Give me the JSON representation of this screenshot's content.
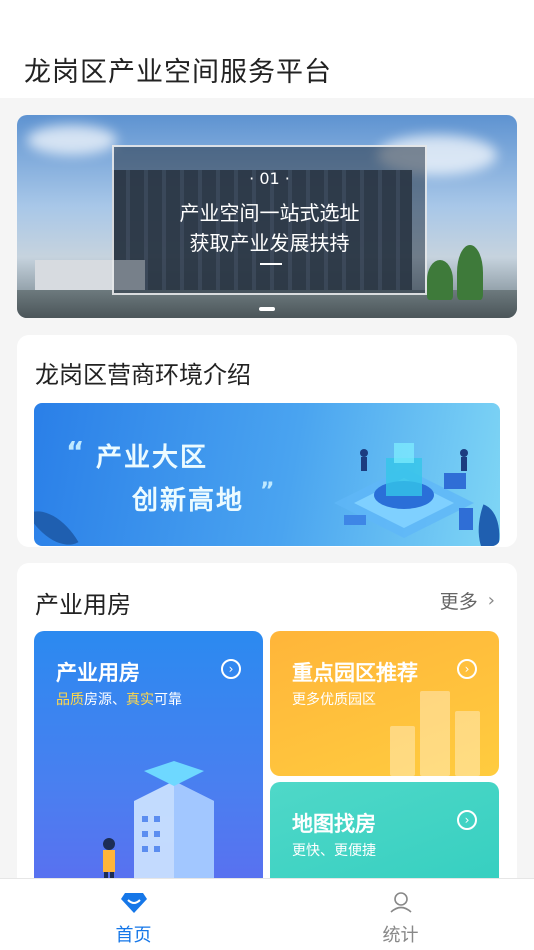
{
  "header": {
    "title": "龙岗区产业空间服务平台"
  },
  "banner": {
    "index": "· 01 ·",
    "line1": "产业空间一站式选址",
    "line2": "获取产业发展扶持",
    "slide_count": 1
  },
  "intro": {
    "heading": "龙岗区营商环境介绍",
    "quote_open": "“",
    "quote_close": "”",
    "slogan1": "产业大区",
    "slogan2": "创新高地"
  },
  "industrial": {
    "heading": "产业用房",
    "more_label": "更多",
    "tiles": [
      {
        "title": "产业用房",
        "sub_hl1": "品质",
        "sub_1": "房源、",
        "sub_hl2": "真实",
        "sub_2": "可靠"
      },
      {
        "title": "重点园区推荐",
        "sub": "更多优质园区"
      },
      {
        "title": "地图找房",
        "sub": "更快、更便捷"
      }
    ]
  },
  "nav": {
    "items": [
      {
        "label": "首页",
        "active": true
      },
      {
        "label": "统计",
        "active": false
      }
    ]
  },
  "colors": {
    "accent": "#1677e8",
    "orange": "#ffb53a",
    "teal": "#4fd8c8",
    "blue": "#2b8af0"
  },
  "icons": [
    "arrow-circle-icon",
    "chevron-right-icon",
    "home-diamond-icon",
    "stats-person-icon"
  ]
}
